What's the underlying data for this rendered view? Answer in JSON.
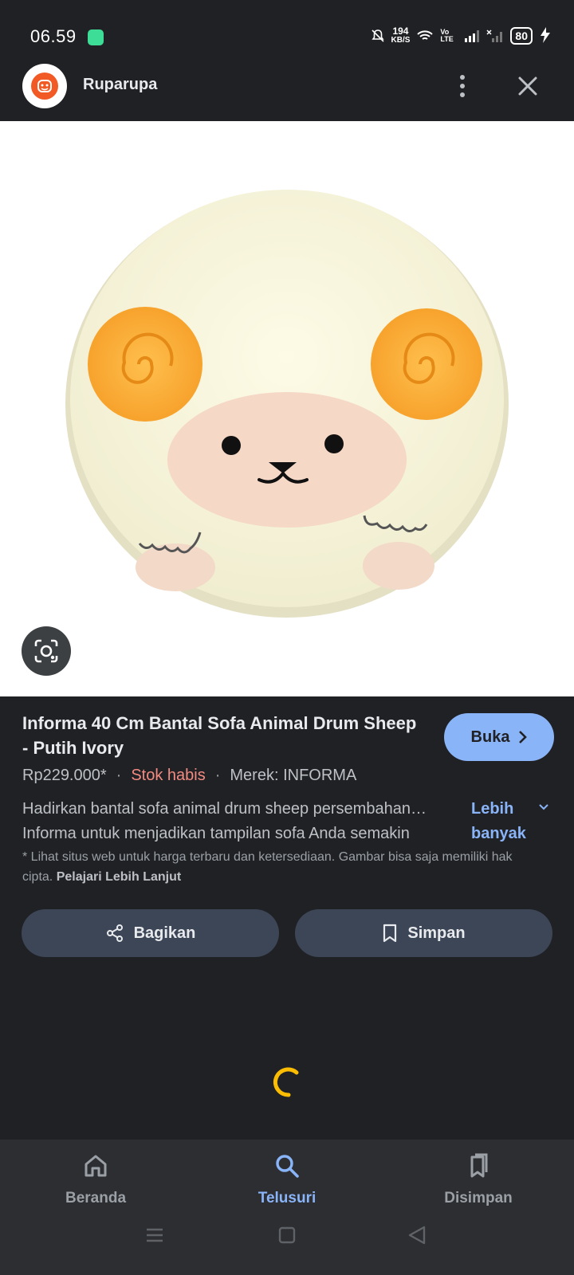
{
  "status_bar": {
    "time": "06.59",
    "net_speed_value": "194",
    "net_speed_unit": "KB/S",
    "volte": "Vo LTE",
    "battery": "80"
  },
  "header": {
    "site_name": "Ruparupa"
  },
  "product": {
    "title": "Informa 40 Cm Bantal Sofa Animal Drum Sheep - Putih Ivory",
    "price": "Rp229.000*",
    "stock": "Stok habis",
    "brand": "Merek: INFORMA",
    "description_line1": "Hadirkan bantal sofa animal drum sheep persembahan…",
    "description_line2": "Informa untuk menjadikan tampilan sofa Anda semakin",
    "more_label": "Lebih banyak",
    "open_label": "Buka",
    "disclaimer": "* Lihat situs web untuk harga terbaru dan ketersediaan. Gambar bisa saja memiliki hak cipta.",
    "learn_more": "Pelajari Lebih Lanjut"
  },
  "actions": {
    "share_label": "Bagikan",
    "save_label": "Simpan"
  },
  "bottom_nav": {
    "items": [
      {
        "label": "Beranda",
        "icon": "home-icon"
      },
      {
        "label": "Telusuri",
        "icon": "search-icon",
        "active": true
      },
      {
        "label": "Disimpan",
        "icon": "collections-icon"
      }
    ]
  },
  "colors": {
    "accent": "#8ab4f8",
    "stock_out": "#f28b82",
    "background": "#202124",
    "brand_orange": "#f15a24"
  }
}
